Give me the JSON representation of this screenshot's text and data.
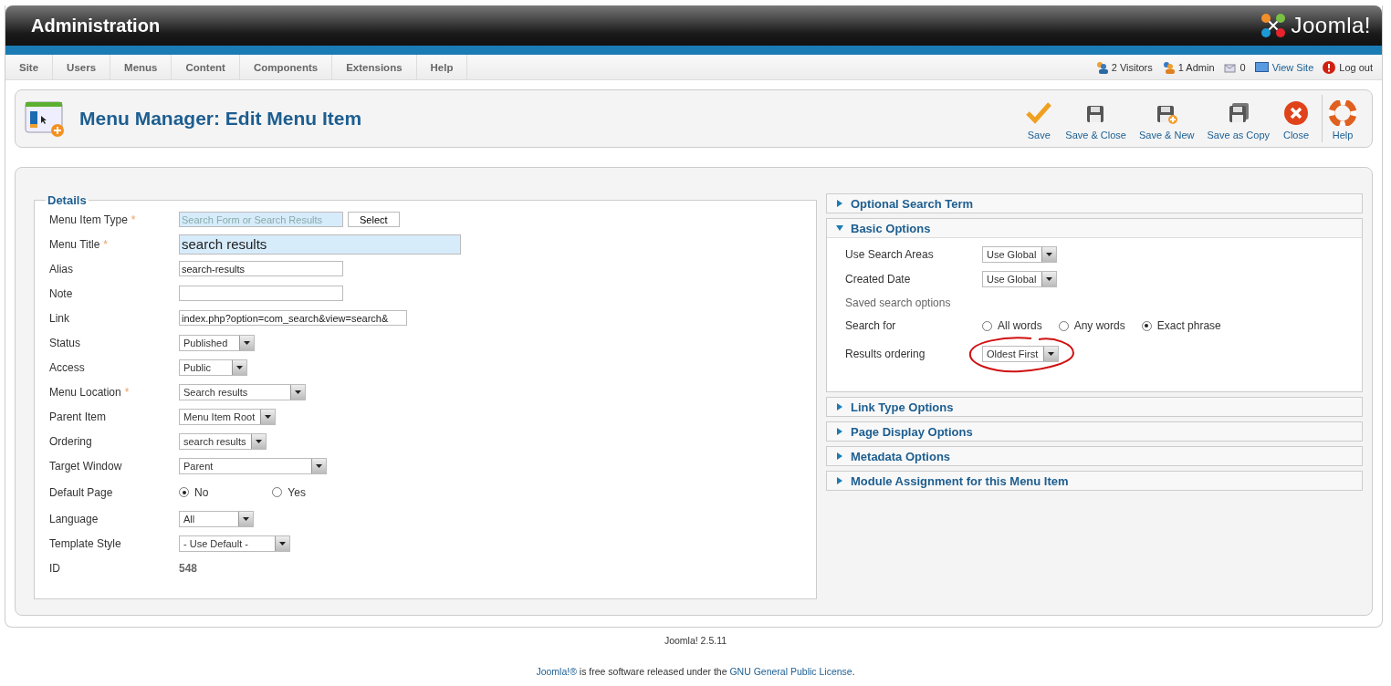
{
  "header": {
    "title": "Administration",
    "logo_text": "Joomla!"
  },
  "menu": [
    {
      "label": "Site"
    },
    {
      "label": "Users"
    },
    {
      "label": "Menus"
    },
    {
      "label": "Content"
    },
    {
      "label": "Components"
    },
    {
      "label": "Extensions"
    },
    {
      "label": "Help"
    }
  ],
  "status": [
    {
      "kind": "visitors",
      "label": "2 Visitors"
    },
    {
      "kind": "admins",
      "label": "1 Admin"
    },
    {
      "kind": "messages",
      "label": "0"
    },
    {
      "kind": "view-site",
      "label": "View Site"
    },
    {
      "kind": "logout",
      "label": "Log out"
    }
  ],
  "toolbar": {
    "title": "Menu Manager: Edit Menu Item",
    "buttons": [
      {
        "kind": "save",
        "label": "Save"
      },
      {
        "kind": "save-close",
        "label": "Save & Close"
      },
      {
        "kind": "save-new",
        "label": "Save & New"
      },
      {
        "kind": "save-copy",
        "label": "Save as Copy"
      },
      {
        "kind": "close",
        "label": "Close"
      },
      {
        "kind": "help",
        "label": "Help"
      }
    ]
  },
  "details": {
    "legend": "Details",
    "fields": [
      {
        "kind": "readonly",
        "label": "Menu Item Type",
        "required_mark": "*",
        "value": "Search Form or Search Results",
        "button": "Select"
      },
      {
        "kind": "title",
        "label": "Menu Title",
        "required_mark": "*",
        "value": "search results"
      },
      {
        "kind": "text",
        "label": "Alias",
        "value": "search-results"
      },
      {
        "kind": "text",
        "label": "Note"
      },
      {
        "kind": "text",
        "label": "Link",
        "value": "index.php?option=com_search&view=search&"
      },
      {
        "kind": "select",
        "label": "Status",
        "value": "Published"
      },
      {
        "kind": "select",
        "label": "Access",
        "value": "Public"
      },
      {
        "kind": "select",
        "label": "Menu Location",
        "required_mark": "*",
        "value": "Search results"
      },
      {
        "kind": "select",
        "label": "Parent Item",
        "value": "Menu Item Root"
      },
      {
        "kind": "select",
        "label": "Ordering",
        "value": "search results"
      },
      {
        "kind": "select",
        "label": "Target Window",
        "value": "Parent"
      },
      {
        "kind": "radio",
        "label": "Default Page",
        "options": [
          {
            "label": "No",
            "selected": true
          },
          {
            "label": "Yes",
            "selected": false
          }
        ]
      },
      {
        "kind": "select",
        "label": "Language",
        "value": "All"
      },
      {
        "kind": "select",
        "label": "Template Style",
        "value": "- Use Default -"
      },
      {
        "kind": "static",
        "label": "ID",
        "value": "548"
      }
    ]
  },
  "panels": [
    {
      "title": "Optional Search Term",
      "expanded": false
    },
    {
      "title": "Basic Options",
      "expanded": true,
      "fields": [
        {
          "kind": "select",
          "label": "Use Search Areas",
          "value": "Use Global"
        },
        {
          "kind": "select",
          "label": "Created Date",
          "value": "Use Global"
        },
        {
          "kind": "heading",
          "label": "Saved search options"
        },
        {
          "kind": "radio",
          "label": "Search for",
          "options": [
            {
              "label": "All words",
              "selected": false
            },
            {
              "label": "Any words",
              "selected": false
            },
            {
              "label": "Exact phrase",
              "selected": true
            }
          ]
        },
        {
          "kind": "select",
          "label": "Results ordering",
          "value": "Oldest First",
          "circled": true
        }
      ]
    },
    {
      "title": "Link Type Options",
      "expanded": false
    },
    {
      "title": "Page Display Options",
      "expanded": false
    },
    {
      "title": "Metadata Options",
      "expanded": false
    },
    {
      "title": "Module Assignment for this Menu Item",
      "expanded": false
    }
  ],
  "footer": {
    "version": "Joomla! 2.5.11",
    "license": [
      {
        "text": "Joomla!®",
        "link": true
      },
      {
        "text": " is free software released under the ",
        "link": false
      },
      {
        "text": "GNU General Public License",
        "link": true
      },
      {
        "text": ".",
        "link": false
      }
    ]
  }
}
